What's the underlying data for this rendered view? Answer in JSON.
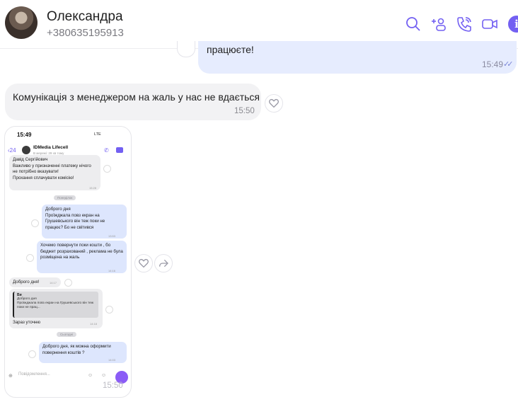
{
  "header": {
    "contact_name": "Олександра",
    "contact_phone": "+380635195913",
    "icons": [
      "search-icon",
      "add-participant-icon",
      "call-icon",
      "video-call-icon",
      "info-icon"
    ],
    "accent_color": "#7360f2"
  },
  "messages": {
    "outgoing_partial": {
      "text": "працюєте!",
      "time": "15:49",
      "ticks": "✓✓"
    },
    "incoming": {
      "text": "Комунікація з менеджером на жаль у нас не вдається",
      "time": "15:50"
    },
    "screenshot_time": "15:50"
  },
  "screenshot": {
    "status_time": "15:49",
    "status_indicators": "LTE",
    "back_count": "24",
    "chat_title": "IDMedia Lifecell",
    "chat_subtitle": "В мережі: 29 хв тому",
    "msg1": {
      "text": "Давід Сергійович\nВажливо у призначенні платежу нічого не потрібно вказувати!\nПрохання сплачувати комісію!",
      "time": "15:28"
    },
    "date1": "Понеділок",
    "msg2": {
      "text": "Доброго дня\nПроїжджала повз екран на Грушевського він теж поки не працює? Бо не світився",
      "time": "13:53"
    },
    "msg3": {
      "text": "Хочемо повернути поки кошти , бо бюджет розрахований , реклама не була розміщена на жаль",
      "time": "14:16"
    },
    "msg4": {
      "text": "Доброго дня!",
      "time": "14:17"
    },
    "quote": {
      "author": "Ви",
      "text": "Доброго дня\nПроїжджала повз екран на Грушевського він теж поки не прац..."
    },
    "msg5": {
      "text": "Зараз уточню",
      "time": "14:18"
    },
    "date2": "Сьогодні",
    "msg6": {
      "text": "Доброго дня, як можна оформити повернення коштів ?",
      "time": "14:03"
    },
    "input_placeholder": "Повідомлення..."
  }
}
